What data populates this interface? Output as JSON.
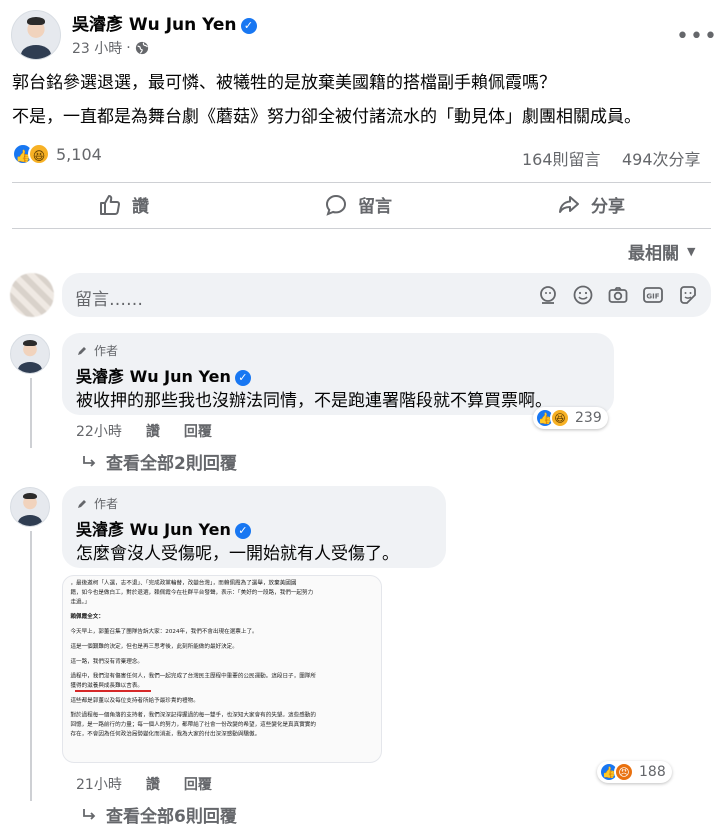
{
  "post": {
    "author_name": "吳濬彥 Wu Jun Yen",
    "time": "23 小時",
    "privacy_icon": "globe-icon",
    "menu_icon": "more-icon",
    "text_line1": "郭台銘參選退選，最可憐、被犧牲的是放棄美國籍的搭檔副手賴佩霞嗎？",
    "text_line2": "不是，一直都是為舞台劇《蘑菇》努力卻全被付諸流水的「動見体」劇團相關成員。",
    "reaction_count": "5,104",
    "comments_count": "164則留言",
    "shares_count": "494次分享"
  },
  "actions": {
    "like": "讚",
    "comment": "留言",
    "share": "分享"
  },
  "sort_label": "最相關",
  "comment_input": {
    "placeholder": "留言……"
  },
  "comments": [
    {
      "author_tag": "作者",
      "author_name": "吳濬彥 Wu Jun Yen",
      "text": "被收押的那些我也沒辦法同情，不是跑連署階段就不算買票啊。",
      "time": "22小時",
      "like_label": "讚",
      "reply_label": "回覆",
      "reaction_count": "239",
      "view_replies": "查看全部2則回覆"
    },
    {
      "author_tag": "作者",
      "author_name": "吳濬彥 Wu Jun Yen",
      "text": "怎麼會沒人受傷呢，一開始就有人受傷了。",
      "time": "21小時",
      "like_label": "讚",
      "reply_label": "回覆",
      "reaction_count": "188",
      "view_replies": "查看全部6則回覆",
      "attachment": {
        "lines": [
          "，最後邀柯「人選，志不退」、「完成政黨輪替，改變台灣」，而賴佩霞為了選舉，放棄美國國",
          "籍，如今也是做白工，對於退選，賴佩霞今在社群平台發聲，表示：「美好的一段路，我們一起努力",
          "走過。」",
          "賴佩霞全文：",
          "今天早上，郭董召集了團隊告訴大家：2024年，我們不會出現在選票上了。",
          "這是一個艱難的決定，但也是再三思考後，此刻所能做的最好決定。",
          "這一路，我們沒有背棄理念。",
          "過程中，我們沒有傷害任何人，我們一起完成了台灣民主歷程中重要的公民運動。這段日子，團隊所",
          "獲得的滋養與成長難以言表。",
          "這些都是郭董以及每位支持者所給予最珍貴的禮物。",
          "對於過程每一個角落的支持者，我們深深記得握過的每一雙手，也深知大家會有的失望。這些感動的",
          "回憶，是一路前行的力量；每一個人的努力，都帶給了社會一份改變的希望，這些變化是真真實實的",
          "存在，不會因為任何政治局勢變化而消逝，我為大家的付出深深感動與驕傲。"
        ]
      }
    }
  ],
  "colors": {
    "primary": "#1877f2",
    "muted": "#65676b",
    "bubble": "#f0f2f5"
  }
}
